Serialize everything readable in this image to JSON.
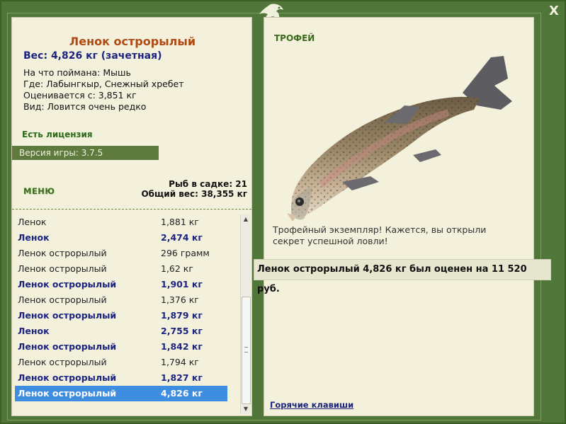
{
  "header": {
    "close_label": "X"
  },
  "info": {
    "fish_name": "Ленок острорылый",
    "weight_line": "Вес: 4,826 кг (зачетная)",
    "bait": "На что поймана: Мышь",
    "location": "Где: Лабынгкыр, Снежный хребет",
    "valued_from": "Оценивается с: 3,851 кг",
    "rarity": "Вид: Ловится очень редко",
    "license": "Есть лицензия",
    "version": "Версия игры: 3.7.5"
  },
  "menu": {
    "label": "МЕНЮ"
  },
  "summary": {
    "keepnet_count": "Рыб в садке: 21",
    "total_weight": "Общий вес: 38,355 кг"
  },
  "catch_list": [
    {
      "name": "Ленок",
      "weight": "1,881 кг",
      "highlight": false,
      "selected": false
    },
    {
      "name": "Ленок",
      "weight": "2,474 кг",
      "highlight": true,
      "selected": false
    },
    {
      "name": "Ленок острорылый",
      "weight": "296 грамм",
      "highlight": false,
      "selected": false
    },
    {
      "name": "Ленок острорылый",
      "weight": "1,62 кг",
      "highlight": false,
      "selected": false
    },
    {
      "name": "Ленок острорылый",
      "weight": "1,901 кг",
      "highlight": true,
      "selected": false
    },
    {
      "name": "Ленок острорылый",
      "weight": "1,376 кг",
      "highlight": false,
      "selected": false
    },
    {
      "name": "Ленок острорылый",
      "weight": "1,879 кг",
      "highlight": true,
      "selected": false
    },
    {
      "name": "Ленок",
      "weight": "2,755 кг",
      "highlight": true,
      "selected": false
    },
    {
      "name": "Ленок острорылый",
      "weight": "1,842 кг",
      "highlight": true,
      "selected": false
    },
    {
      "name": "Ленок острорылый",
      "weight": "1,794 кг",
      "highlight": false,
      "selected": false
    },
    {
      "name": "Ленок острорылый",
      "weight": "1,827 кг",
      "highlight": true,
      "selected": false
    },
    {
      "name": "Ленок острорылый",
      "weight": "4,826 кг",
      "highlight": false,
      "selected": true
    }
  ],
  "trophy": {
    "header": "ТРОФЕЙ",
    "text": "Трофейный экземпляр! Кажется, вы открыли секрет успешной ловли!",
    "hotkeys_link": "Горячие клавиши"
  },
  "tooltip": {
    "text": "Ленок острорылый 4,826 кг был оценен на 11 520 руб."
  },
  "colors": {
    "frame": "#51763a",
    "panel": "#f3f1dc",
    "accent_title": "#b04a13",
    "accent_blue": "#1c2480",
    "selection": "#3d8de0"
  }
}
